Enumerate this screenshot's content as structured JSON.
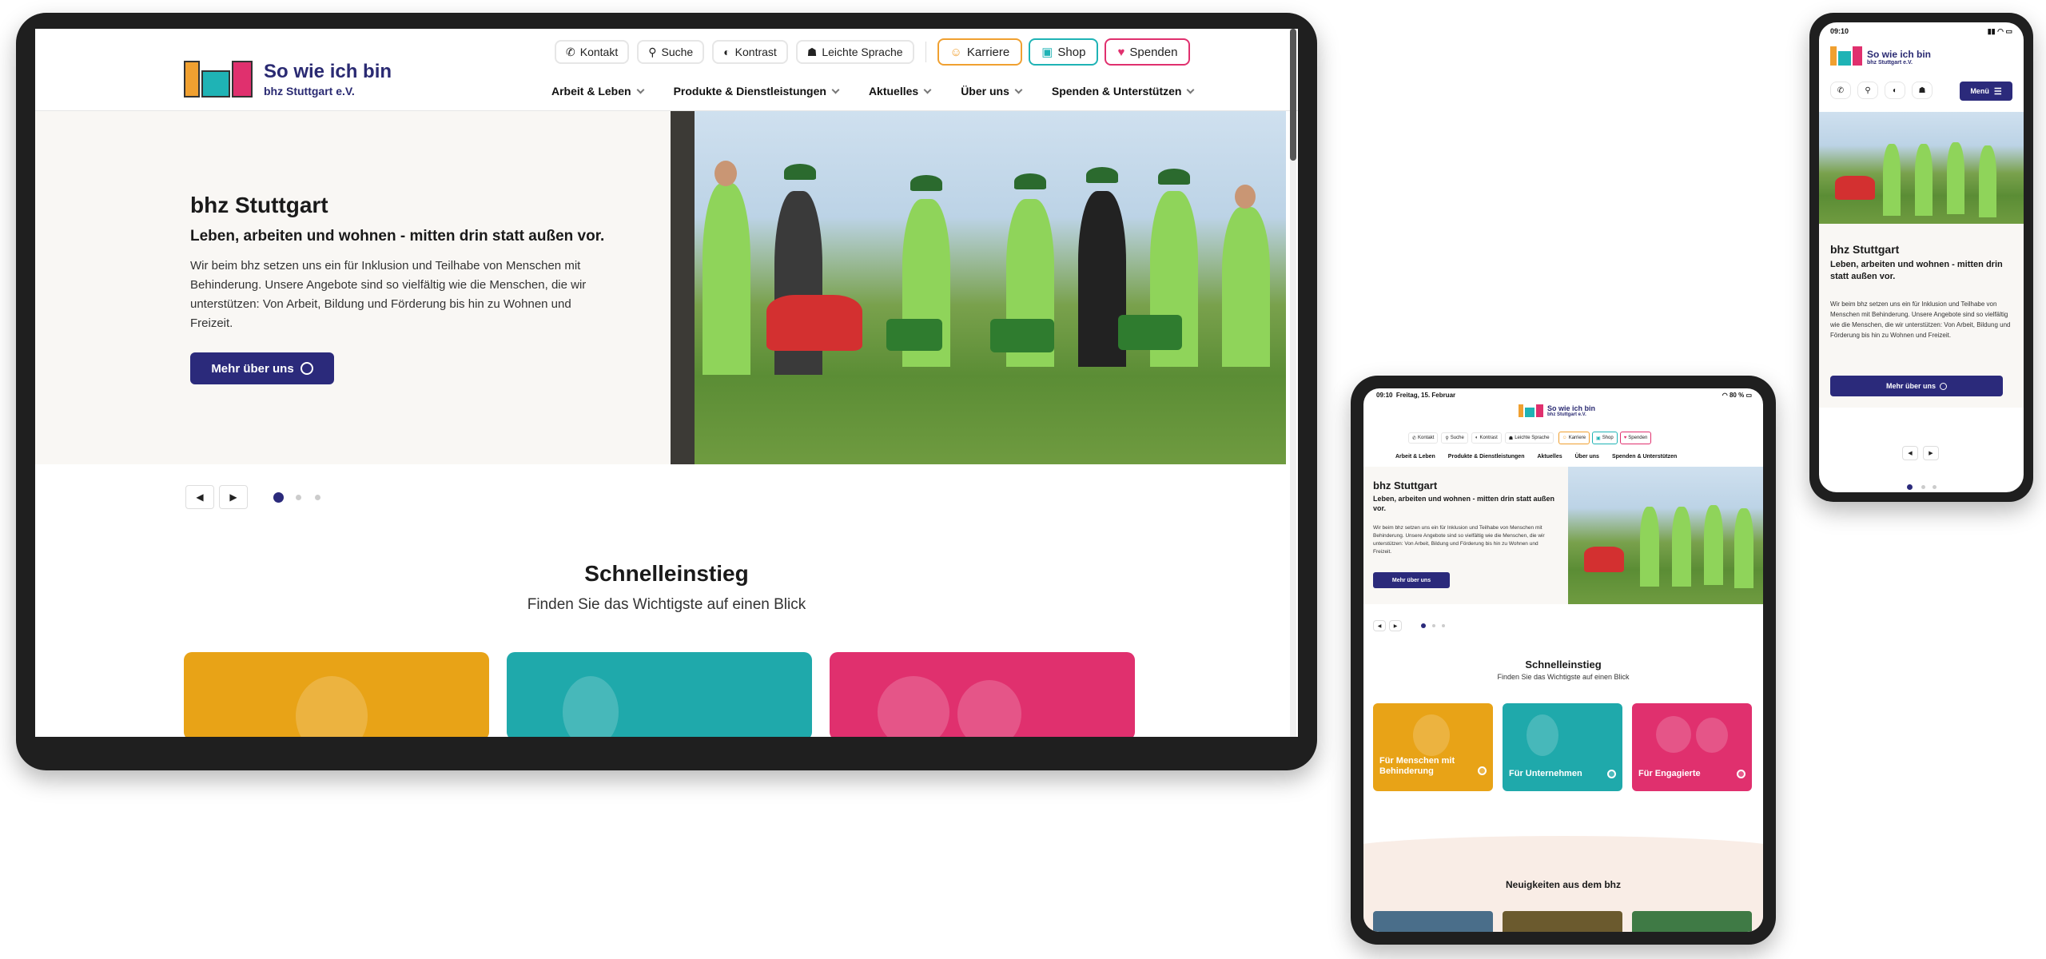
{
  "brand": {
    "title": "So wie ich bin",
    "subtitle": "bhz Stuttgart e.V."
  },
  "utility": {
    "kontakt": "Kontakt",
    "suche": "Suche",
    "kontrast": "Kontrast",
    "leichte_sprache": "Leichte Sprache",
    "karriere": "Karriere",
    "shop": "Shop",
    "spenden": "Spenden"
  },
  "nav": {
    "arbeit": "Arbeit & Leben",
    "produkte": "Produkte & Dienstleistungen",
    "aktuelles": "Aktuelles",
    "ueber": "Über uns",
    "spenden": "Spenden & Unterstützen"
  },
  "hero": {
    "title": "bhz Stuttgart",
    "subtitle": "Leben, arbeiten und wohnen - mitten drin statt außen vor.",
    "text": "Wir beim bhz setzen uns ein für Inklusion und Teilhabe von Menschen mit Behinderung. Unsere Angebote sind so vielfältig wie die Menschen, die wir unterstützen: Von Arbeit, Bildung und Förderung bis hin zu Wohnen und Freizeit.",
    "button": "Mehr über uns"
  },
  "schnell": {
    "title": "Schnelleinstieg",
    "subtitle": "Finden Sie das Wichtigste auf einen Blick"
  },
  "cards": {
    "menschen": "Für Menschen mit Behinderung",
    "unternehmen": "Für Unternehmen",
    "engagierte": "Für Engagierte"
  },
  "news": {
    "title": "Neuigkeiten aus dem bhz"
  },
  "tablet_status": {
    "time": "09:10",
    "date": "Freitag, 15. Februar",
    "battery": "80 %"
  },
  "phone_status": {
    "time": "09:10"
  },
  "phone_menu": "Menü",
  "colors": {
    "brand": "#2b2a7b",
    "orange": "#e8a317",
    "teal": "#1fa9ab",
    "pink": "#e0306e"
  }
}
